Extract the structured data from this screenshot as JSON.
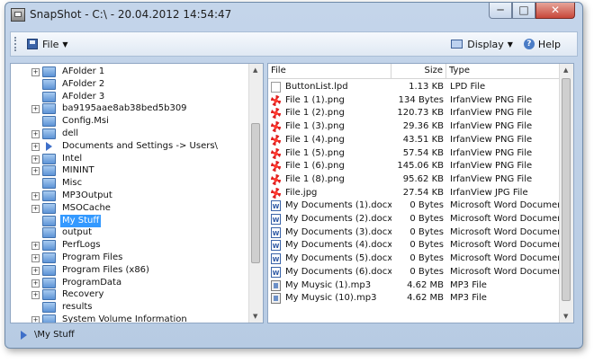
{
  "window": {
    "title": "SnapShot - C:\\ - 20.04.2012 14:54:47"
  },
  "toolbar": {
    "file_label": "File",
    "display_label": "Display",
    "help_label": "Help"
  },
  "tree": {
    "items": [
      {
        "label": "AFolder 1",
        "expander": "+",
        "icon": "folder-icon"
      },
      {
        "label": "AFolder 2",
        "expander": "",
        "icon": "folder-icon"
      },
      {
        "label": "AFolder 3",
        "expander": "",
        "icon": "folder-icon"
      },
      {
        "label": "ba9195aae8ab38bed5b309",
        "expander": "+",
        "icon": "folder-icon"
      },
      {
        "label": "Config.Msi",
        "expander": "",
        "icon": "folder-icon"
      },
      {
        "label": "dell",
        "expander": "+",
        "icon": "folder-icon"
      },
      {
        "label": "Documents and Settings -> Users\\",
        "expander": "+",
        "icon": "link-arrow-icon"
      },
      {
        "label": "Intel",
        "expander": "+",
        "icon": "folder-icon"
      },
      {
        "label": "MININT",
        "expander": "+",
        "icon": "folder-icon"
      },
      {
        "label": "Misc",
        "expander": "",
        "icon": "folder-icon"
      },
      {
        "label": "MP3Output",
        "expander": "+",
        "icon": "folder-icon"
      },
      {
        "label": "MSOCache",
        "expander": "+",
        "icon": "folder-icon"
      },
      {
        "label": "My Stuff",
        "expander": "",
        "icon": "folder-icon",
        "selected": true
      },
      {
        "label": "output",
        "expander": "",
        "icon": "folder-icon"
      },
      {
        "label": "PerfLogs",
        "expander": "+",
        "icon": "folder-icon"
      },
      {
        "label": "Program Files",
        "expander": "+",
        "icon": "folder-icon"
      },
      {
        "label": "Program Files (x86)",
        "expander": "+",
        "icon": "folder-icon"
      },
      {
        "label": "ProgramData",
        "expander": "+",
        "icon": "folder-icon"
      },
      {
        "label": "Recovery",
        "expander": "+",
        "icon": "folder-icon"
      },
      {
        "label": "results",
        "expander": "",
        "icon": "folder-icon"
      },
      {
        "label": "System Volume Information",
        "expander": "+",
        "icon": "folder-icon"
      }
    ]
  },
  "files": {
    "columns": [
      "File",
      "Size",
      "Type"
    ],
    "rows": [
      {
        "name": "ButtonList.lpd",
        "size": "1.13 KB",
        "type": "LPD File",
        "icon": "lpd"
      },
      {
        "name": "File 1 (1).png",
        "size": "134 Bytes",
        "type": "IrfanView PNG File",
        "icon": "img"
      },
      {
        "name": "File 1 (2).png",
        "size": "120.73 KB",
        "type": "IrfanView PNG File",
        "icon": "img"
      },
      {
        "name": "File 1 (3).png",
        "size": "29.36 KB",
        "type": "IrfanView PNG File",
        "icon": "img"
      },
      {
        "name": "File 1 (4).png",
        "size": "43.51 KB",
        "type": "IrfanView PNG File",
        "icon": "img"
      },
      {
        "name": "File 1 (5).png",
        "size": "57.54 KB",
        "type": "IrfanView PNG File",
        "icon": "img"
      },
      {
        "name": "File 1 (6).png",
        "size": "145.06 KB",
        "type": "IrfanView PNG File",
        "icon": "img"
      },
      {
        "name": "File 1 (8).png",
        "size": "95.62 KB",
        "type": "IrfanView PNG File",
        "icon": "img"
      },
      {
        "name": "File.jpg",
        "size": "27.54 KB",
        "type": "IrfanView JPG File",
        "icon": "img"
      },
      {
        "name": "My Documents (1).docx",
        "size": "0 Bytes",
        "type": "Microsoft Word Document",
        "icon": "doc"
      },
      {
        "name": "My Documents (2).docx",
        "size": "0 Bytes",
        "type": "Microsoft Word Document",
        "icon": "doc"
      },
      {
        "name": "My Documents (3).docx",
        "size": "0 Bytes",
        "type": "Microsoft Word Document",
        "icon": "doc"
      },
      {
        "name": "My Documents (4).docx",
        "size": "0 Bytes",
        "type": "Microsoft Word Document",
        "icon": "doc"
      },
      {
        "name": "My Documents (5).docx",
        "size": "0 Bytes",
        "type": "Microsoft Word Document",
        "icon": "doc"
      },
      {
        "name": "My Documents (6).docx",
        "size": "0 Bytes",
        "type": "Microsoft Word Document",
        "icon": "doc"
      },
      {
        "name": "My Muysic (1).mp3",
        "size": "4.62 MB",
        "type": "MP3 File",
        "icon": "mp3"
      },
      {
        "name": "My Muysic (10).mp3",
        "size": "4.62 MB",
        "type": "MP3 File",
        "icon": "mp3"
      }
    ]
  },
  "statusbar": {
    "path": "\\My Stuff"
  }
}
